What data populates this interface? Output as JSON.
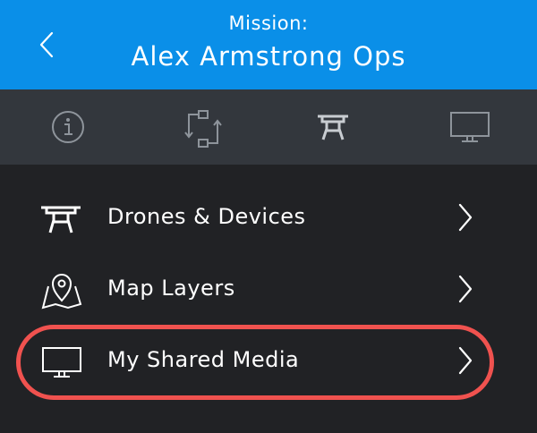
{
  "header": {
    "title_label": "Mission:",
    "mission_name": "Alex Armstrong Ops",
    "back_icon": "chevron-left-icon"
  },
  "tabs": [
    {
      "icon": "info-icon",
      "active": false
    },
    {
      "icon": "sync-icon",
      "active": false
    },
    {
      "icon": "drone-icon",
      "active": true
    },
    {
      "icon": "monitor-icon",
      "active": false
    }
  ],
  "menu": {
    "items": [
      {
        "label": "Drones & Devices",
        "icon": "drone-icon"
      },
      {
        "label": "Map Layers",
        "icon": "map-pin-icon"
      },
      {
        "label": "My Shared Media",
        "icon": "monitor-icon",
        "highlighted": true
      }
    ]
  },
  "colors": {
    "header_bg": "#0a8fe8",
    "tabbar_bg": "#33373d",
    "body_bg": "#212225",
    "highlight": "#f0524f",
    "icon_inactive": "#8e949b",
    "icon_active": "#c8ccd1"
  }
}
